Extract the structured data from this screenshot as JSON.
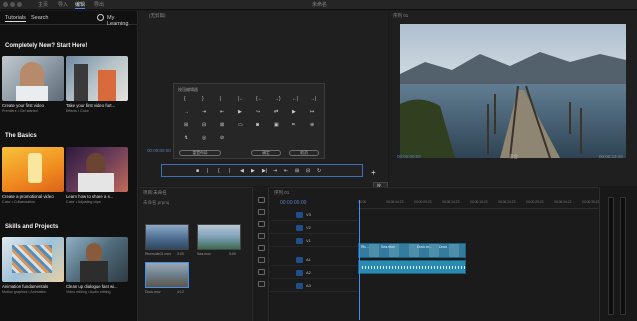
{
  "window": {
    "title": "未命名",
    "nav": [
      "主页",
      "导入",
      "编辑",
      "导出"
    ],
    "active_nav": "编辑"
  },
  "learn": {
    "tabs": [
      "Tutorials",
      "Search"
    ],
    "my_learning": "My Learning",
    "sections": [
      {
        "title": "Completely New? Start Here!",
        "cards": [
          {
            "title": "Create your first video",
            "sub": "Premiere  •  Get started"
          },
          {
            "title": "Take your first video furt...",
            "sub": "Effects  •  Color"
          }
        ]
      },
      {
        "title": "The Basics",
        "cards": [
          {
            "title": "Create a promotional video",
            "sub": "Color  •  Collaboration"
          },
          {
            "title": "Learn how to share a s...",
            "sub": "Color  •  Adjusting clips"
          }
        ]
      },
      {
        "title": "Skills and Projects",
        "cards": [
          {
            "title": "Animation fundamentals",
            "sub": "Motion graphics  •  Animation"
          },
          {
            "title": "Clean up dialogue fast wi...",
            "sub": "Video editing  •  Audio editing"
          }
        ]
      }
    ]
  },
  "source": {
    "title": "(无剪辑)",
    "timecode_left": "00:00:00:00",
    "button_editor_title": "按钮编辑器",
    "buttons_row1": [
      "{",
      "}",
      "|",
      "|←",
      "{←",
      "→}",
      "←|",
      "→|"
    ],
    "buttons_row2": [
      "→",
      "⇥",
      "⇤",
      "▶",
      "↪",
      "⇄",
      "▶",
      "↦"
    ],
    "buttons_row3": [
      "⊞",
      "⊟",
      "⊠",
      "▭",
      "◙",
      "▣",
      "⌗",
      "⊕"
    ],
    "buttons_row4": [
      "↯",
      "◎",
      "⊘"
    ],
    "pill_reset": "重置布局",
    "pill_ok": "确定",
    "pill_cancel": "取消",
    "toolbar_icons": [
      "■",
      "|",
      "{",
      "|",
      "◀",
      "▶",
      "▶|",
      "⇥",
      "⇤",
      "⊞",
      "⊟",
      "↻"
    ],
    "add_symbol": "+",
    "tooltip": "按钮编辑器"
  },
  "program": {
    "title": "序列 01",
    "timecode_left": "00:00:00:00",
    "fit": "适合",
    "timecode_right": "00:00:23:15",
    "ratio": "1/2"
  },
  "project": {
    "title": "项目:未命名",
    "subtitle": "未命名.prproj",
    "clips": [
      {
        "label": "Riverside01.mov",
        "dur": "3:00"
      },
      {
        "label": "Sea.mov",
        "dur": "3:00"
      },
      {
        "label": "Dock.mov",
        "dur": "4:12"
      }
    ]
  },
  "timeline": {
    "title": "序列 01",
    "timecode": "00:00:00:00",
    "ruler": [
      "00:00",
      "00:00:04:23",
      "00:00:09:23",
      "00:00:14:23",
      "00:00:19:23",
      "00:00:24:23",
      "00:00:29:23",
      "00:00:34:22",
      "00:00:39:22"
    ],
    "tracks": [
      "V3",
      "V2",
      "V1",
      "A1",
      "A2",
      "A3"
    ],
    "video_clips": [
      "Riv...",
      "Sea.mov",
      "Dock.m...",
      "Dock",
      "Riv..."
    ],
    "audio_label": "fx"
  }
}
